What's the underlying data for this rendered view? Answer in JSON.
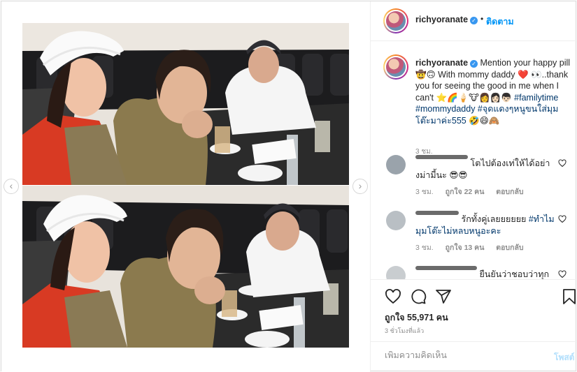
{
  "post": {
    "username": "richyoranate",
    "verified_glyph": "✓",
    "separator": "•",
    "follow_label": "ติดตาม",
    "caption": {
      "text_line": "Mention your happy pill 🤠🙃 With mommy daddy ❤️ 👀..thank you for seeing the good in me when I can't ⭐🌈🍦🐮👩👩🏻👦🏻",
      "hashtags": "#familytime #mommydaddy #จุดแดงๆหนูขนใส่มุมโต๊ะมาค่ะ555",
      "trailing_emoji": "🤣😄🙈",
      "time": "3 ชม."
    },
    "comments": [
      {
        "username_masked": "username",
        "text": "โตไปต้องเท่ให้ได้อย่างม่ามี้นะ 😎😎",
        "time": "3 ชม.",
        "likes": "ถูกใจ 22 คน",
        "reply": "ตอบกลับ"
      },
      {
        "username_masked": "user",
        "text": "รักทั้งคู่เลยยยยยย ",
        "hashtag": "#ทำไมมุมโต๊ะไม่หลบหนูอะคะ",
        "time": "3 ชม.",
        "likes": "ถูกใจ 13 คน",
        "reply": "ตอบกลับ"
      },
      {
        "username_masked": "username",
        "text": "ยืนยันว่าชอบว่าทุก"
      }
    ],
    "likes_text": "ถูกใจ 55,971 คน",
    "age_text": "3 ชั่วโมงที่แล้ว",
    "add_comment_placeholder": "เพิ่มความคิดเห็น",
    "post_label": "โพสต์",
    "nav": {
      "left": "‹",
      "right": "›"
    }
  },
  "icons": [
    "heart-icon",
    "comment-icon",
    "share-icon",
    "save-icon",
    "verified-icon",
    "chevron-left-icon",
    "chevron-right-icon"
  ],
  "colors": {
    "link": "#0095f6",
    "hashtag": "#00376b",
    "muted": "#8e8e8e",
    "verified": "#3897f0"
  }
}
